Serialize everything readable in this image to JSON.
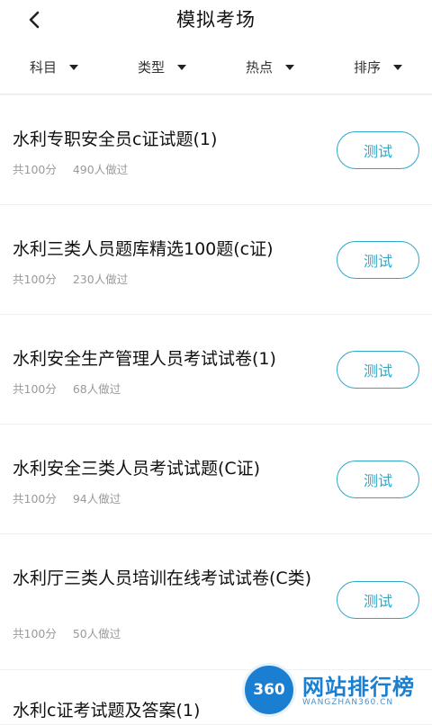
{
  "header": {
    "title": "模拟考场"
  },
  "filters": [
    {
      "label": "科目"
    },
    {
      "label": "类型"
    },
    {
      "label": "热点"
    },
    {
      "label": "排序"
    }
  ],
  "exams": [
    {
      "title": "水利专职安全员c证试题(1)",
      "score": "共100分",
      "takers": "490人做过",
      "button": "测试"
    },
    {
      "title": "水利三类人员题库精选100题(c证)",
      "score": "共100分",
      "takers": "230人做过",
      "button": "测试"
    },
    {
      "title": "水利安全生产管理人员考试试卷(1)",
      "score": "共100分",
      "takers": "68人做过",
      "button": "测试"
    },
    {
      "title": "水利安全三类人员考试试题(C证)",
      "score": "共100分",
      "takers": "94人做过",
      "button": "测试"
    },
    {
      "title": "水利厅三类人员培训在线考试试卷(C类)",
      "score": "共100分",
      "takers": "50人做过",
      "button": "测试"
    },
    {
      "title": "水利c证考试题及答案(1)",
      "score": "",
      "takers": "",
      "button": ""
    }
  ],
  "watermark": {
    "badge": "360",
    "name": "网站排行榜",
    "url": "WANGZHAN360.CN"
  },
  "colors": {
    "accent": "#2ea7c9",
    "brand": "#1a7fd0"
  },
  "icons": {
    "back": "chevron-left-icon",
    "dropdown": "caret-down-icon"
  }
}
